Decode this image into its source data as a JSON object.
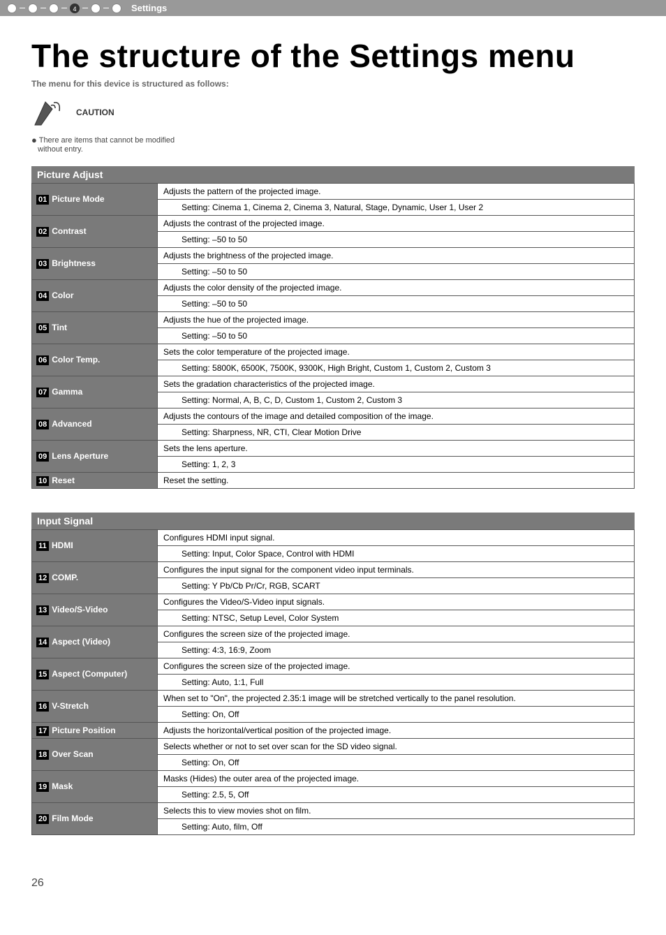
{
  "breadcrumb": {
    "active_num": "4",
    "label": "Settings"
  },
  "title": "The structure of the Settings menu",
  "subtitle": "The menu for this device is structured as follows:",
  "caution_label": "CAUTION",
  "note_bullet": "●",
  "note_text_1": "There are items that cannot be modified",
  "note_text_2": "without entry.",
  "sections": {
    "picture_adjust": {
      "header": "Picture Adjust",
      "rows": [
        {
          "num": "01",
          "label": "Picture Mode",
          "desc": "Adjusts the pattern of the projected image.",
          "setting": "Setting: Cinema 1, Cinema 2, Cinema 3, Natural, Stage, Dynamic, User 1, User 2"
        },
        {
          "num": "02",
          "label": "Contrast",
          "desc": "Adjusts the contrast of the projected image.",
          "setting": "Setting: –50 to 50"
        },
        {
          "num": "03",
          "label": "Brightness",
          "desc": "Adjusts the brightness of the projected image.",
          "setting": "Setting: –50 to 50"
        },
        {
          "num": "04",
          "label": "Color",
          "desc": "Adjusts the color density of the projected image.",
          "setting": "Setting: –50 to 50"
        },
        {
          "num": "05",
          "label": "Tint",
          "desc": "Adjusts the hue of the projected image.",
          "setting": "Setting: –50 to 50"
        },
        {
          "num": "06",
          "label": "Color Temp.",
          "desc": "Sets the color temperature of the projected image.",
          "setting": "Setting: 5800K, 6500K, 7500K, 9300K, High Bright, Custom 1, Custom 2, Custom 3"
        },
        {
          "num": "07",
          "label": "Gamma",
          "desc": "Sets the gradation characteristics of the projected image.",
          "setting": "Setting: Normal, A, B, C, D, Custom 1, Custom 2, Custom 3"
        },
        {
          "num": "08",
          "label": "Advanced",
          "desc": "Adjusts the contours of the image and detailed composition of the image.",
          "setting": "Setting: Sharpness, NR, CTI, Clear Motion Drive"
        },
        {
          "num": "09",
          "label": "Lens Aperture",
          "desc": "Sets the lens aperture.",
          "setting": "Setting: 1, 2, 3"
        },
        {
          "num": "10",
          "label": "Reset",
          "desc": "Reset the setting.",
          "setting": null
        }
      ]
    },
    "input_signal": {
      "header": "Input Signal",
      "rows": [
        {
          "num": "11",
          "label": "HDMI",
          "desc": "Configures HDMI input signal.",
          "setting": "Setting: Input, Color Space, Control with HDMI"
        },
        {
          "num": "12",
          "label": "COMP.",
          "desc": "Configures the input signal for the component video input terminals.",
          "setting": "Setting: Y Pb/Cb Pr/Cr, RGB, SCART"
        },
        {
          "num": "13",
          "label": "Video/S-Video",
          "desc": "Configures the Video/S-Video input signals.",
          "setting": "Setting: NTSC, Setup Level, Color System"
        },
        {
          "num": "14",
          "label": "Aspect (Video)",
          "desc": "Configures the screen size of the projected image.",
          "setting": "Setting: 4:3, 16:9, Zoom"
        },
        {
          "num": "15",
          "label": "Aspect (Computer)",
          "desc": "Configures the screen size of the projected image.",
          "setting": "Setting: Auto, 1:1, Full"
        },
        {
          "num": "16",
          "label": "V-Stretch",
          "desc": "When set to \"On\", the projected 2.35:1 image will be stretched vertically to the panel resolution.",
          "setting": "Setting: On, Off"
        },
        {
          "num": "17",
          "label": "Picture Position",
          "desc": "Adjusts the horizontal/vertical position of the projected image.",
          "setting": null
        },
        {
          "num": "18",
          "label": "Over Scan",
          "desc": "Selects whether or not to set over scan for the SD video signal.",
          "setting": "Setting: On, Off"
        },
        {
          "num": "19",
          "label": "Mask",
          "desc": "Masks (Hides) the outer area of the projected image.",
          "setting": "Setting: 2.5, 5, Off"
        },
        {
          "num": "20",
          "label": "Film Mode",
          "desc": "Selects this to view movies shot on film.",
          "setting": "Setting: Auto, film, Off"
        }
      ]
    }
  },
  "page_number": "26"
}
